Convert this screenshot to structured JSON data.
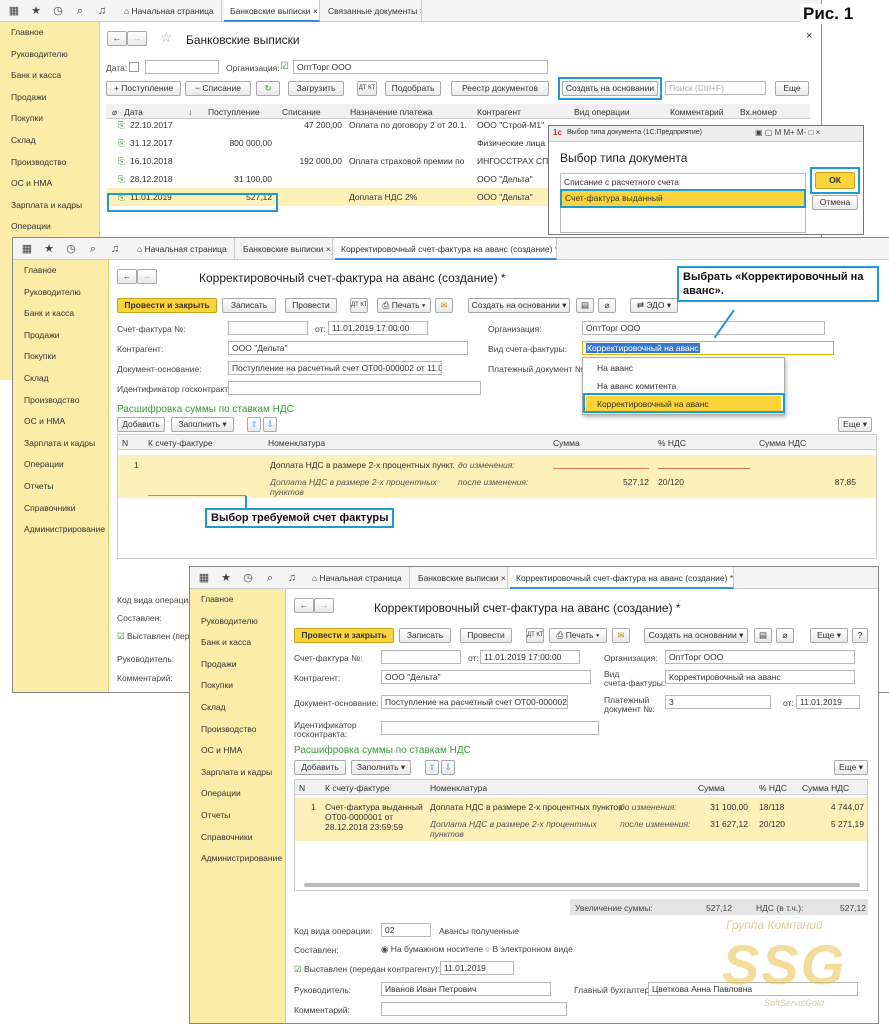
{
  "figure_label": "Рис. 1",
  "win1": {
    "tabs": [
      "Начальная страница",
      "Банковские выписки",
      "Связанные документы"
    ],
    "sidebar": [
      "Главное",
      "Руководителю",
      "Банк и касса",
      "Продажи",
      "Покупки",
      "Склад",
      "Производство",
      "ОС и НМА",
      "Зарплата и кадры",
      "Операции"
    ],
    "title": "Банковские выписки",
    "date_label": "Дата:",
    "org_label": "Организация:",
    "org_value": "ОптТорг ООО",
    "btn_income": "+ Поступление",
    "btn_outflow": "− Списание",
    "btn_load": "Загрузить",
    "btn_select": "Подобрать",
    "btn_registry": "Реестр документов",
    "btn_create": "Создать на основании",
    "search_placeholder": "Поиск (Ctrl+F)",
    "btn_more": "Еще",
    "columns": [
      "Дата",
      "Поступление",
      "Списание",
      "Назначение платежа",
      "Контрагент",
      "Вид операции",
      "Комментарий",
      "Вх.номер"
    ],
    "rows": [
      {
        "date": "22.10.2017",
        "in": "",
        "out": "47 200,00",
        "purpose": "Оплата по договору 2 от 20.1...",
        "party": "ООО \"Строй-М1\""
      },
      {
        "date": "31.12.2017",
        "in": "800 000,00",
        "out": "",
        "purpose": "",
        "party": "Физические лица"
      },
      {
        "date": "16.10.2018",
        "in": "",
        "out": "192 000,00",
        "purpose": "Оплата страховой премии по ...",
        "party": "ИНГОССТРАХ СПА"
      },
      {
        "date": "28.12.2018",
        "in": "31 100,00",
        "out": "",
        "purpose": "",
        "party": "ООО \"Дельта\""
      },
      {
        "date": "11.01.2019",
        "in": "527,12",
        "out": "",
        "purpose": "Доплата НДС 2%",
        "party": "ООО \"Дельта\""
      }
    ]
  },
  "dialog": {
    "titlebar": "Выбор типа документа (1С:Предприятие)",
    "heading": "Выбор типа документа",
    "items": [
      "Списание с расчетного счета",
      "Счет-фактура выданный"
    ],
    "ok": "ОК",
    "cancel": "Отмена",
    "controls": [
      "M",
      "M+",
      "M-"
    ]
  },
  "win2": {
    "tabs": [
      "Начальная страница",
      "Банковские выписки",
      "Корректировочный счет-фактура на аванс (создание) *"
    ],
    "sidebar": [
      "Главное",
      "Руководителю",
      "Банк и касса",
      "Продажи",
      "Покупки",
      "Склад",
      "Производство",
      "ОС и НМА",
      "Зарплата и кадры",
      "Операции",
      "Отчеты",
      "Справочники",
      "Администрирование"
    ],
    "title": "Корректировочный счет-фактура на аванс (создание) *",
    "btn_post_close": "Провести и закрыть",
    "btn_save": "Записать",
    "btn_post": "Провести",
    "btn_print": "Печать",
    "btn_create": "Создать на основании",
    "btn_edo": "ЭДО",
    "invoice_label": "Счет-фактура №:",
    "from_label": "от:",
    "datetime": "11.01.2019 17:00:00",
    "org_label": "Организация:",
    "org_value": "ОптТорг ООО",
    "contractor_label": "Контрагент:",
    "contractor_value": "ООО \"Дельта\"",
    "kind_label": "Вид счета-фактуры:",
    "kind_value": "Корректировочный на аванс",
    "basis_label": "Документ-основание:",
    "basis_value": "Поступление на расчетный счет ОТ00-000002 от 11.01.20",
    "paydoc_label": "Платежный документ №:",
    "gov_id_label": "Идентификатор госконтракта:",
    "section": "Расшифровка суммы по ставкам НДС",
    "btn_add": "Добавить",
    "btn_fill": "Заполнить",
    "btn_more": "Еще",
    "columns": [
      "N",
      "К счету-фактуре",
      "Номенклатура",
      "Сумма",
      "% НДС",
      "Сумма НДС"
    ],
    "row_n": "1",
    "line1": "Доплата НДС в размере 2-х процентных пункт...",
    "before": "до изменения:",
    "line2": "Доплата НДС в размере 2-х процентных пунктов",
    "after": "после изменения:",
    "sum_after": "527,12",
    "vat_after": "20/120",
    "vatsum_after": "87,85",
    "dropdown": [
      "На аванс",
      "На аванс комитента",
      "Корректировочный на аванс"
    ],
    "bottom_labels": [
      "Код вида операции:",
      "Составлен:",
      "Выставлен (пере",
      "Руководитель:",
      "Комментарий:"
    ],
    "callout_kind": "Выбрать «Корректировочный на аванс».",
    "callout_invoice": "Выбор требуемой счет фактуры"
  },
  "win3": {
    "tabs": [
      "Начальная страница",
      "Банковские выписки",
      "Корректировочный счет-фактура на аванс (создание) *"
    ],
    "sidebar": [
      "Главное",
      "Руководителю",
      "Банк и касса",
      "Продажи",
      "Покупки",
      "Склад",
      "Производство",
      "ОС и НМА",
      "Зарплата и кадры",
      "Операции",
      "Отчеты",
      "Справочники",
      "Администрирование"
    ],
    "title": "Корректировочный счет-фактура на аванс (создание) *",
    "btn_post_close": "Провести и закрыть",
    "btn_save": "Записать",
    "btn_post": "Провести",
    "btn_print": "Печать",
    "btn_create": "Создать на основании",
    "btn_more": "Еще",
    "btn_help": "?",
    "invoice_label": "Счет-фактура №:",
    "from_label": "от:",
    "datetime": "11.01.2019 17:00:00",
    "org_label": "Организация:",
    "org_value": "ОптТорг ООО",
    "contractor_label": "Контрагент:",
    "contractor_value": "ООО \"Дельта\"",
    "kind_label1": "Вид",
    "kind_label2": "счета-фактуры:",
    "kind_value": "Корректировочный на аванс",
    "basis_label": "Документ-основание:",
    "basis_value": "Поступление на расчетный счет ОТ00-000002 о",
    "paydoc_label1": "Платежный",
    "paydoc_label2": "документ №:",
    "paydoc_value": "3",
    "paydoc_from": "от:",
    "paydoc_date": "11.01.2019",
    "gov_id_label1": "Идентификатор",
    "gov_id_label2": "госконтракта:",
    "section": "Расшифровка суммы по ставкам НДС",
    "btn_add": "Добавить",
    "btn_fill": "Заполнить",
    "columns": [
      "N",
      "К счету-фактуре",
      "Номенклатура",
      "Сумма",
      "% НДС",
      "Сумма НДС"
    ],
    "row": {
      "n": "1",
      "ref1": "Счет-фактура выданный",
      "ref2": "ОТ00-0000001 от",
      "ref3": "28.12.2018 23:59:59",
      "line1": "Доплата НДС в размере 2-х процентных пунктов",
      "before": "до изменения:",
      "sum_before": "31 100,00",
      "vat_before": "18/118",
      "vatsum_before": "4 744,07",
      "line2a": "Доплата НДС в размере 2-х процентных",
      "line2b": "пунктов",
      "after": "после изменения:",
      "sum_after": "31 627,12",
      "vat_after": "20/120",
      "vatsum_after": "5 271,19"
    },
    "increase_label": "Увеличение суммы:",
    "increase_value": "527,12",
    "vat_incl_label": "НДС (в т.ч.):",
    "vat_incl_value": "527,12",
    "op_code_label": "Код вида операции:",
    "op_code_value": "02",
    "op_code_text": "Авансы полученные",
    "made_label": "Составлен:",
    "paper": "На бумажном носителе",
    "electronic": "В электронном виде",
    "issued_label": "Выставлен (передан контрагенту):",
    "issued_date": "11.01.2019",
    "head_label": "Руководитель:",
    "head_value": "Иванов Иван Петрович",
    "accountant_label": "Главный бухгалтер:",
    "accountant_value": "Цветкова Анна Павловна",
    "comment_label": "Комментарий:"
  },
  "watermark": {
    "line1": "Группа Компаний",
    "logo": "SSG",
    "line3": "SoftServisGold"
  }
}
